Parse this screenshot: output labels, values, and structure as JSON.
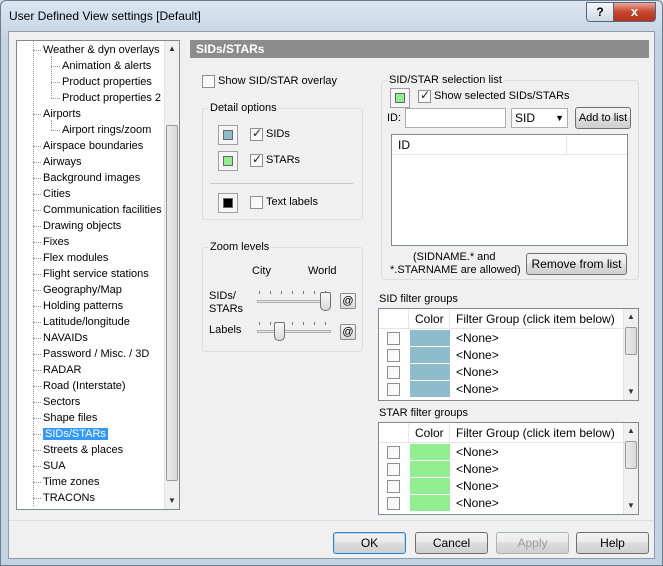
{
  "window": {
    "title": "User Defined View settings  [Default]",
    "help_glyph": "?",
    "close_glyph": "x"
  },
  "tree": {
    "items": [
      {
        "label": "Weather & dyn overlays",
        "level": 0
      },
      {
        "label": "Animation & alerts",
        "level": 1
      },
      {
        "label": "Product properties",
        "level": 1
      },
      {
        "label": "Product properties 2",
        "level": 1
      },
      {
        "label": "Airports",
        "level": 0
      },
      {
        "label": "Airport rings/zoom",
        "level": 1
      },
      {
        "label": "Airspace boundaries",
        "level": 0
      },
      {
        "label": "Airways",
        "level": 0
      },
      {
        "label": "Background images",
        "level": 0
      },
      {
        "label": "Cities",
        "level": 0
      },
      {
        "label": "Communication facilities",
        "level": 0
      },
      {
        "label": "Drawing objects",
        "level": 0
      },
      {
        "label": "Fixes",
        "level": 0
      },
      {
        "label": "Flex modules",
        "level": 0
      },
      {
        "label": "Flight service stations",
        "level": 0
      },
      {
        "label": "Geography/Map",
        "level": 0
      },
      {
        "label": "Holding patterns",
        "level": 0
      },
      {
        "label": "Latitude/longitude",
        "level": 0
      },
      {
        "label": "NAVAIDs",
        "level": 0
      },
      {
        "label": "Password / Misc. / 3D",
        "level": 0
      },
      {
        "label": "RADAR",
        "level": 0
      },
      {
        "label": "Road (Interstate)",
        "level": 0
      },
      {
        "label": "Sectors",
        "level": 0
      },
      {
        "label": "Shape files",
        "level": 0
      },
      {
        "label": "SIDs/STARs",
        "level": 0,
        "selected": true
      },
      {
        "label": "Streets & places",
        "level": 0
      },
      {
        "label": "SUA",
        "level": 0
      },
      {
        "label": "Time zones",
        "level": 0
      },
      {
        "label": "TRACONs",
        "level": 0
      }
    ],
    "scroll_up": "▲",
    "scroll_down": "▼"
  },
  "panel": {
    "title": "SIDs/STARs",
    "show_overlay_label": "Show SID/STAR overlay",
    "detail_options": {
      "title": "Detail options",
      "sids_label": "SIDs",
      "stars_label": "STARs",
      "text_labels_label": "Text labels",
      "sid_color": "#8fbccc",
      "star_color": "#90ee90",
      "text_color": "#000000"
    },
    "zoom_levels": {
      "title": "Zoom levels",
      "city_label": "City",
      "world_label": "World",
      "sids_stars_label_1": "SIDs/",
      "sids_stars_label_2": "STARs",
      "labels_label": "Labels",
      "sids_stars_level": 1.0,
      "labels_level": 0.25,
      "at_glyph": "@"
    },
    "selection_list": {
      "title": "SID/STAR selection list",
      "show_selected_label": "Show selected SIDs/STARs",
      "show_selected_color": "#90ee90",
      "id_label": "ID:",
      "id_value": "",
      "type_selected": "SID",
      "add_button": "Add to list",
      "column_id": "ID",
      "note_line1": "(SIDNAME.* and",
      "note_line2": "*.STARNAME are allowed)",
      "remove_button": "Remove from list"
    },
    "sid_filter_groups": {
      "title": "SID filter groups",
      "col_color": "Color",
      "col_group": "Filter Group (click item below)",
      "row_color": "#8fbccc",
      "rows": [
        "<None>",
        "<None>",
        "<None>",
        "<None>"
      ]
    },
    "star_filter_groups": {
      "title": "STAR filter groups",
      "col_color": "Color",
      "col_group": "Filter Group (click item below)",
      "row_color": "#90ee90",
      "rows": [
        "<None>",
        "<None>",
        "<None>",
        "<None>"
      ]
    }
  },
  "footer": {
    "ok": "OK",
    "cancel": "Cancel",
    "apply": "Apply",
    "help": "Help"
  }
}
